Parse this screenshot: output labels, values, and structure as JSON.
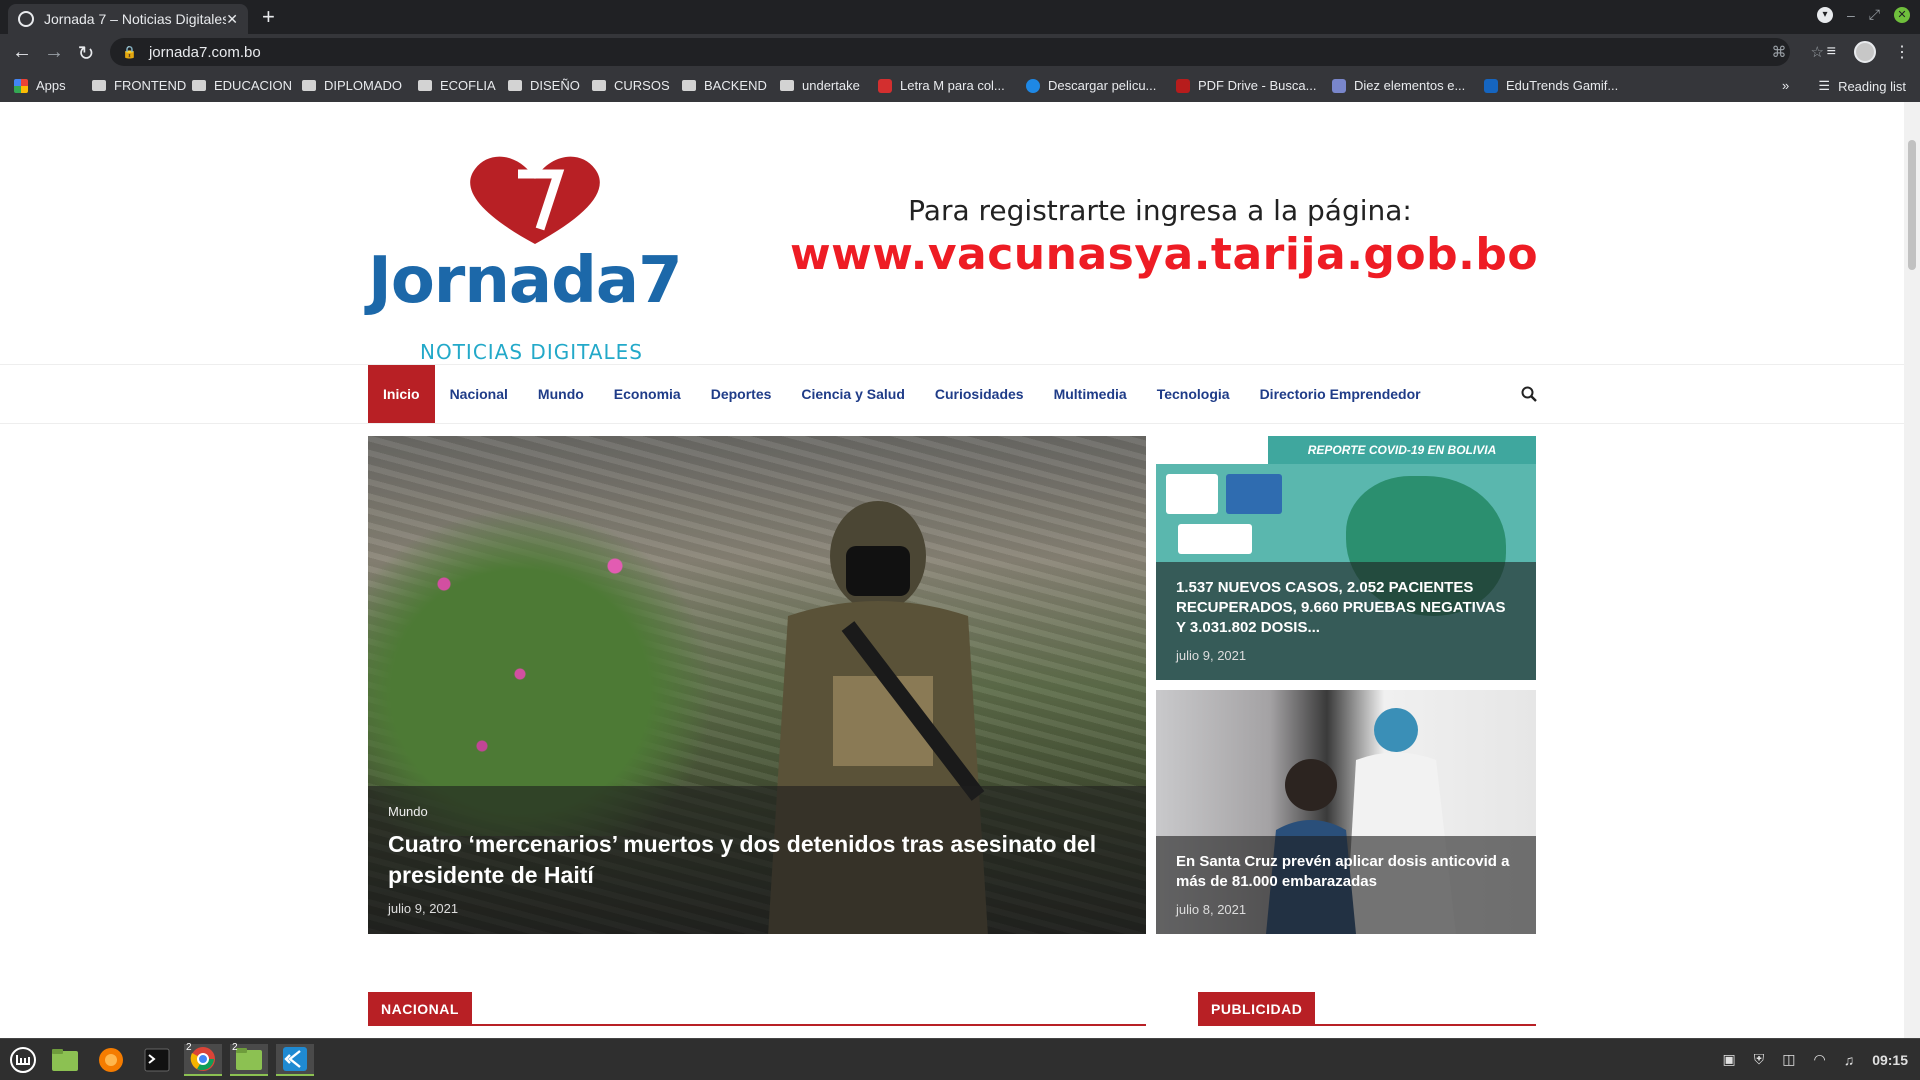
{
  "browser": {
    "tab_title": "Jornada 7 – Noticias Digitales",
    "tab_close": "✕",
    "new_tab": "+",
    "url": "jornada7.com.bo",
    "bookmarks": [
      {
        "label": "Apps",
        "icon": "apps-grid-icon"
      },
      {
        "label": "FRONTEND",
        "icon": "folder-icon"
      },
      {
        "label": "EDUCACION",
        "icon": "folder-icon"
      },
      {
        "label": "DIPLOMADO",
        "icon": "folder-icon"
      },
      {
        "label": "ECOFLIA",
        "icon": "folder-icon"
      },
      {
        "label": "DISEÑO",
        "icon": "folder-icon"
      },
      {
        "label": "CURSOS",
        "icon": "folder-icon"
      },
      {
        "label": "BACKEND",
        "icon": "folder-icon"
      },
      {
        "label": "undertake",
        "icon": "folder-icon"
      },
      {
        "label": "Letra M para col...",
        "icon": "site-icon"
      },
      {
        "label": "Descargar pelicu...",
        "icon": "site-icon"
      },
      {
        "label": "PDF Drive - Busca...",
        "icon": "site-icon"
      },
      {
        "label": "Diez elementos e...",
        "icon": "site-icon"
      },
      {
        "label": "EduTrends Gamif...",
        "icon": "site-icon"
      }
    ],
    "bookmarks_more": "»",
    "reading_list": "Reading list"
  },
  "site": {
    "logo_brand": "Jornada7",
    "logo_tagline": "NOTICIAS DIGITALES",
    "banner_line1": "Para registrarte ingresa a la página:",
    "banner_line2": "www.vacunasya.tarija.gob.bo",
    "nav": [
      "Inicio",
      "Nacional",
      "Mundo",
      "Economia",
      "Deportes",
      "Ciencia y Salud",
      "Curiosidades",
      "Multimedia",
      "Tecnologia",
      "Directorio Emprendedor"
    ],
    "active_nav": "Inicio",
    "featured_main": {
      "category": "Mundo",
      "title": "Cuatro ‘mercenarios’ muertos y dos detenidos tras asesinato del presidente de Haití",
      "date": "julio 9, 2021"
    },
    "featured_side": [
      {
        "title": "1.537 NUEVOS CASOS, 2.052 PACIENTES RECUPERADOS, 9.660 PRUEBAS NEGATIVAS Y 3.031.802 DOSIS...",
        "date": "julio 9, 2021",
        "image_header": "REPORTE COVID-19 EN BOLIVIA"
      },
      {
        "title": "En Santa Cruz prevén aplicar dosis anticovid a más de 81.000 embarazadas",
        "date": "julio 8, 2021"
      }
    ],
    "sections": {
      "nacional": "NACIONAL",
      "publicidad": "PUBLICIDAD"
    },
    "colors": {
      "accent": "#b82025",
      "nav_text": "#1f3c88",
      "banner_url": "#ee1c24"
    }
  },
  "taskbar": {
    "clock": "09:15",
    "badge_chrome": "2",
    "badge_files": "2"
  }
}
